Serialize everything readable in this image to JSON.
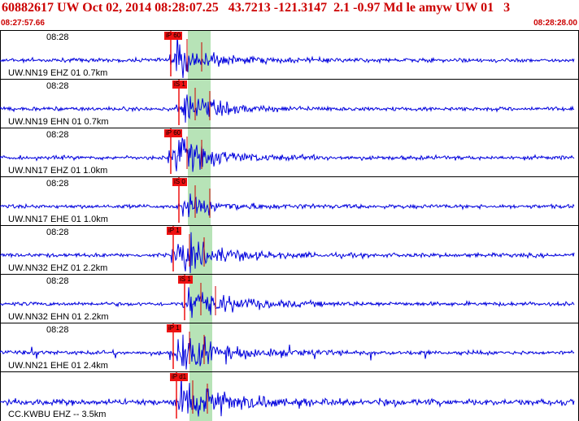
{
  "header": {
    "title": "60882617 UW Oct 02, 2014 08:28:07.25   43.7213 -121.3147  2.1 -0.97 Md le amyw UW 01   3",
    "start_time": "08:27:57.66",
    "end_time": "08:28:28.00"
  },
  "colors": {
    "header_text": "#cc0000",
    "trace": "#0000dd",
    "pick_window": "#b7e3b7",
    "pick_marker": "#ee1111",
    "arrival_line": "#cc0000"
  },
  "panels": [
    {
      "time_label": "08:28",
      "station": "UW.NN19 EHZ 01 0.7km",
      "pick": "iP 60",
      "pick_frac": 0.3,
      "amp": 0.9
    },
    {
      "time_label": "08:28",
      "station": "UW.NN19 EHN 01 0.7km",
      "pick": "iS 1",
      "pick_frac": 0.315,
      "amp": 0.75
    },
    {
      "time_label": "08:28",
      "station": "UW.NN17 EHZ 01 1.0km",
      "pick": "iP 60",
      "pick_frac": 0.3,
      "amp": 0.95
    },
    {
      "time_label": "08:28",
      "station": "UW.NN17 EHE 01 1.0km",
      "pick": "iS 0",
      "pick_frac": 0.315,
      "amp": 0.45
    },
    {
      "time_label": "08:28",
      "station": "UW.NN32 EHZ 01 2.2km",
      "pick": "iP 1",
      "pick_frac": 0.305,
      "amp": 0.85
    },
    {
      "time_label": "08:28",
      "station": "UW.NN32 EHN 01 2.2km",
      "pick": "iS 1",
      "pick_frac": 0.325,
      "amp": 0.75
    },
    {
      "time_label": "08:28",
      "station": "UW.NN21 EHE 01 2.4km",
      "pick": "iP 1",
      "pick_frac": 0.305,
      "amp": 0.9
    },
    {
      "time_label": "",
      "station": "CC.KWBU EHZ -- 3.5km",
      "pick": "iP d1",
      "pick_frac": 0.31,
      "amp": 1.0
    }
  ]
}
